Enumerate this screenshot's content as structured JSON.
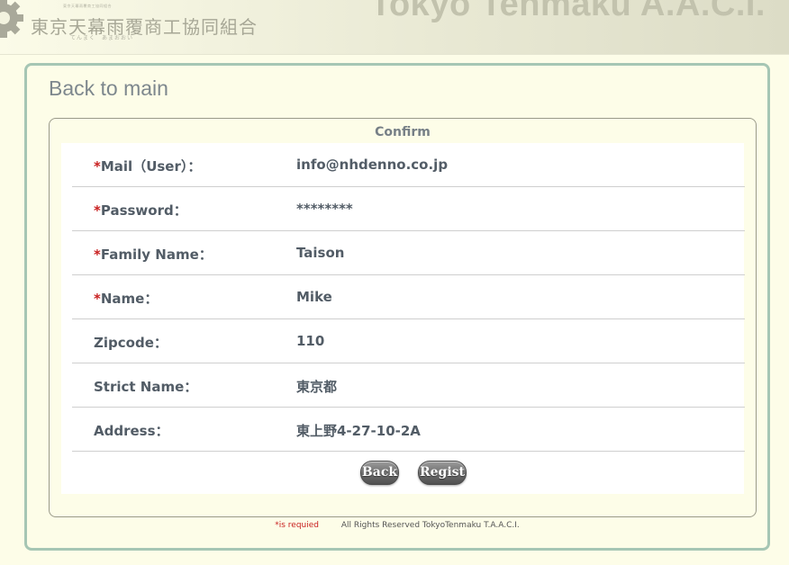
{
  "header": {
    "logo_small_text": "東京天幕雨覆商工協同組合",
    "logo_main": "東京天幕雨覆商工協同組合",
    "logo_kana": "てんまく　あまおおい",
    "site_title": "Tokyo Tenmaku A.A.C.I."
  },
  "nav": {
    "back_to_main": "Back to main"
  },
  "form": {
    "legend": "Confirm",
    "required_mark": "*",
    "rows": [
      {
        "label": "Mail（User）：",
        "value": "info@nhdenno.co.jp",
        "required": true
      },
      {
        "label": "Password：",
        "value": "********",
        "required": true
      },
      {
        "label": "Family Name：",
        "value": "Taison",
        "required": true
      },
      {
        "label": "Name：",
        "value": "Mike",
        "required": true
      },
      {
        "label": "Zipcode：",
        "value": "110",
        "required": false
      },
      {
        "label": "Strict Name：",
        "value": "東京都",
        "required": false
      },
      {
        "label": "Address：",
        "value": "東上野4-27-10-2A",
        "required": false
      }
    ],
    "back_button": "Back",
    "regist_button": "Regist"
  },
  "footer": {
    "required_note": "*is requied",
    "copyright": "All Rights Reserved TokyoTenmaku T.A.A.C.I."
  },
  "colors": {
    "page_bg": "#fdfde8",
    "panel_border": "#a6c6b4",
    "required_red": "#c81e1e",
    "text": "#525c66"
  }
}
